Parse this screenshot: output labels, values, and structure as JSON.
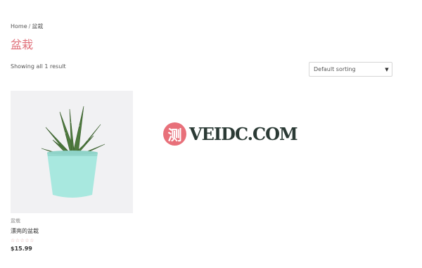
{
  "breadcrumb": {
    "home": "Home",
    "separator": "/",
    "current": "盆栽"
  },
  "page": {
    "title": "盆栽",
    "result_count": "Showing all 1 result"
  },
  "sort": {
    "selected": "Default sorting"
  },
  "product": {
    "category": "盆栽",
    "title": "漂亮的盆栽",
    "rating_stars": "☆☆☆☆☆",
    "price": "$15.99",
    "image": "potted succulent in mint pot"
  },
  "watermark": {
    "badge": "测",
    "text": "VEIDC.COM"
  },
  "icons": {
    "dropdown": "chevron-down-icon"
  },
  "colors": {
    "accent": "#e0707a",
    "pot": "#a8e8df",
    "leaf": "#4e7a3e"
  }
}
